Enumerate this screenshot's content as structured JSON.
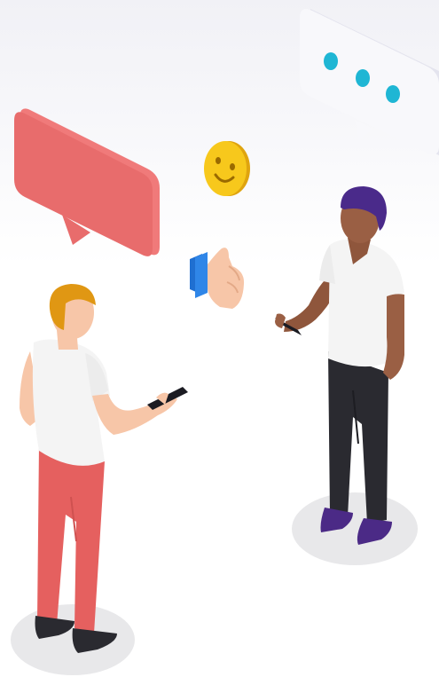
{
  "illustration": {
    "subject": "two-people-chatting-on-phones",
    "icons": [
      "speech-bubble-icon",
      "typing-bubble-icon",
      "smiley-emoji-icon",
      "thumbs-up-icon",
      "phone-icon"
    ],
    "colors": {
      "background_top": "#f1f1f6",
      "red_bubble": "#e86c6c",
      "white_bubble": "#f8f8fb",
      "typing_dots": "#1fb6d4",
      "emoji_yellow": "#f7c81c",
      "thumb_skin": "#f7c6a8",
      "thumb_cuff": "#1f6fd1",
      "shirt": "#f4f4f4",
      "left_pants": "#e5605f",
      "left_hair": "#e09713",
      "right_hair": "#4a2a8a",
      "right_skin": "#9a5f44",
      "right_pants": "#2a2a30",
      "shoes_purple": "#4b2a86",
      "shadow": "#e8e8ea"
    }
  }
}
